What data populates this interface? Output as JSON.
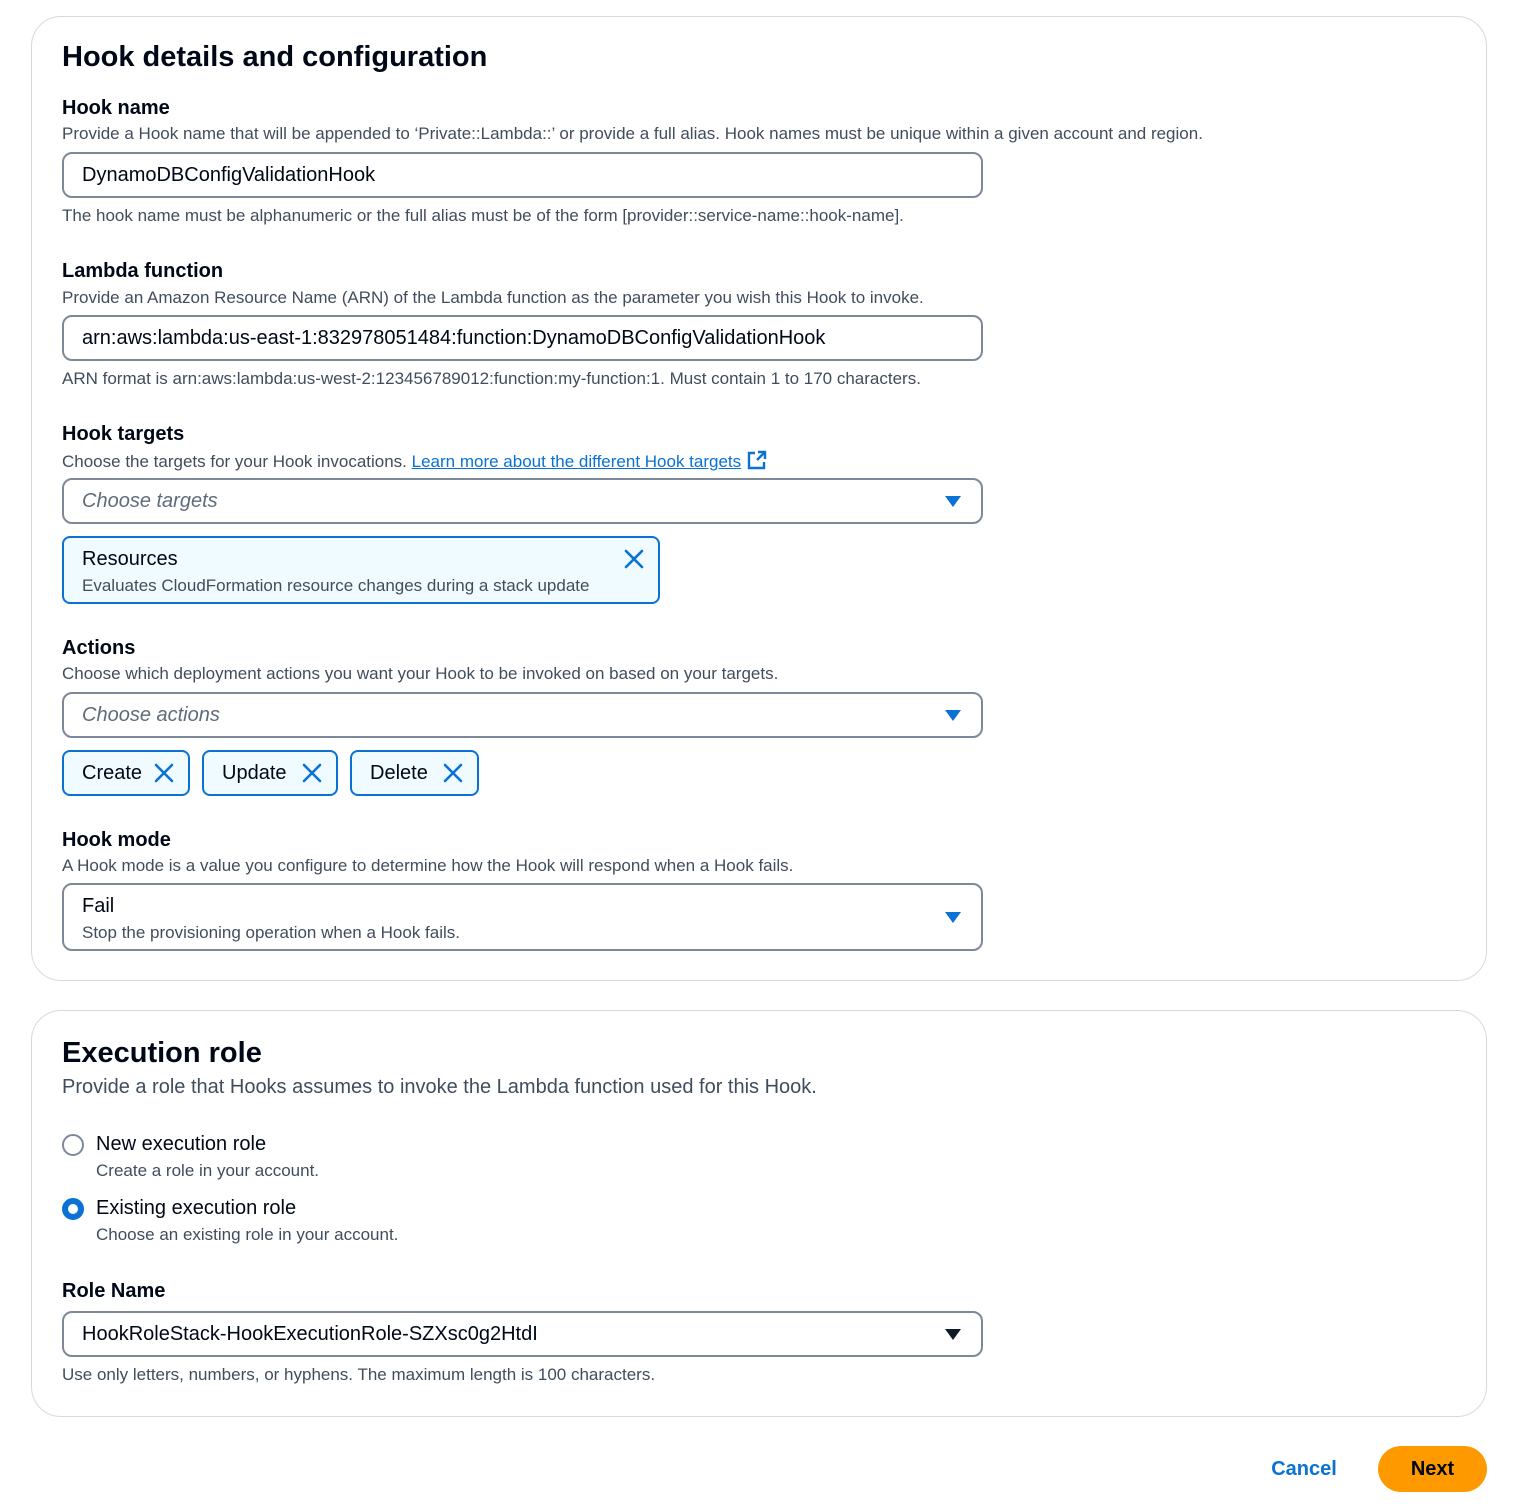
{
  "hook_section": {
    "title": "Hook details and configuration",
    "hook_name": {
      "label": "Hook name",
      "description": "Provide a Hook name that will be appended to ‘Private::Lambda::’ or provide a full alias. Hook names must be unique within a given account and region.",
      "value": "DynamoDBConfigValidationHook",
      "constraint": "The hook name must be alphanumeric or the full alias must be of the form [provider::service-name::hook-name]."
    },
    "lambda_function": {
      "label": "Lambda function",
      "description": "Provide an Amazon Resource Name (ARN) of the Lambda function as the parameter you wish this Hook to invoke.",
      "value": "arn:aws:lambda:us-east-1:832978051484:function:DynamoDBConfigValidationHook",
      "constraint": "ARN format is arn:aws:lambda:us-west-2:123456789012:function:my-function:1. Must contain 1 to 170 characters."
    },
    "hook_targets": {
      "label": "Hook targets",
      "description": "Choose the targets for your Hook invocations.",
      "link_text": "Learn more about the different Hook targets",
      "placeholder": "Choose targets",
      "tokens": [
        {
          "label": "Resources",
          "description": "Evaluates CloudFormation resource changes during a stack update"
        }
      ]
    },
    "actions": {
      "label": "Actions",
      "description": "Choose which deployment actions you want your Hook to be invoked on based on your targets.",
      "placeholder": "Choose actions",
      "tokens": [
        "Create",
        "Update",
        "Delete"
      ]
    },
    "hook_mode": {
      "label": "Hook mode",
      "description": "A Hook mode is a value you configure to determine how the Hook will respond when a Hook fails.",
      "selected_label": "Fail",
      "selected_description": "Stop the provisioning operation when a Hook fails."
    }
  },
  "role_section": {
    "title": "Execution role",
    "description": "Provide a role that Hooks assumes to invoke the Lambda function used for this Hook.",
    "options": [
      {
        "label": "New execution role",
        "description": "Create a role in your account.",
        "checked": false
      },
      {
        "label": "Existing execution role",
        "description": "Choose an existing role in your account.",
        "checked": true
      }
    ],
    "role_name": {
      "label": "Role Name",
      "value": "HookRoleStack-HookExecutionRole-SZXsc0g2HtdI",
      "constraint": "Use only letters, numbers, or hyphens. The maximum length is 100 characters."
    }
  },
  "footer": {
    "cancel_label": "Cancel",
    "next_label": "Next"
  },
  "colors": {
    "accent": "#0972d3",
    "primary_button": "#ff9900",
    "token_bg": "#f0fbff"
  }
}
